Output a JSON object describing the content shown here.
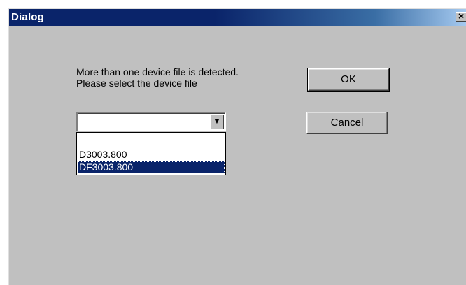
{
  "window": {
    "title": "Dialog",
    "close_glyph": "×"
  },
  "message": {
    "line1": "More than one device file is detected.",
    "line2": "Please select the device file"
  },
  "buttons": {
    "ok_label": "OK",
    "cancel_label": "Cancel"
  },
  "device_select": {
    "value": "",
    "arrow_glyph": "▼",
    "options": [
      "D3003.800",
      "DF3003.800"
    ],
    "highlighted_option": "DF3003.800"
  },
  "colors": {
    "title_bar": "#0a246a",
    "dialog_face": "#c0c0c0",
    "selection": "#0a246a"
  }
}
